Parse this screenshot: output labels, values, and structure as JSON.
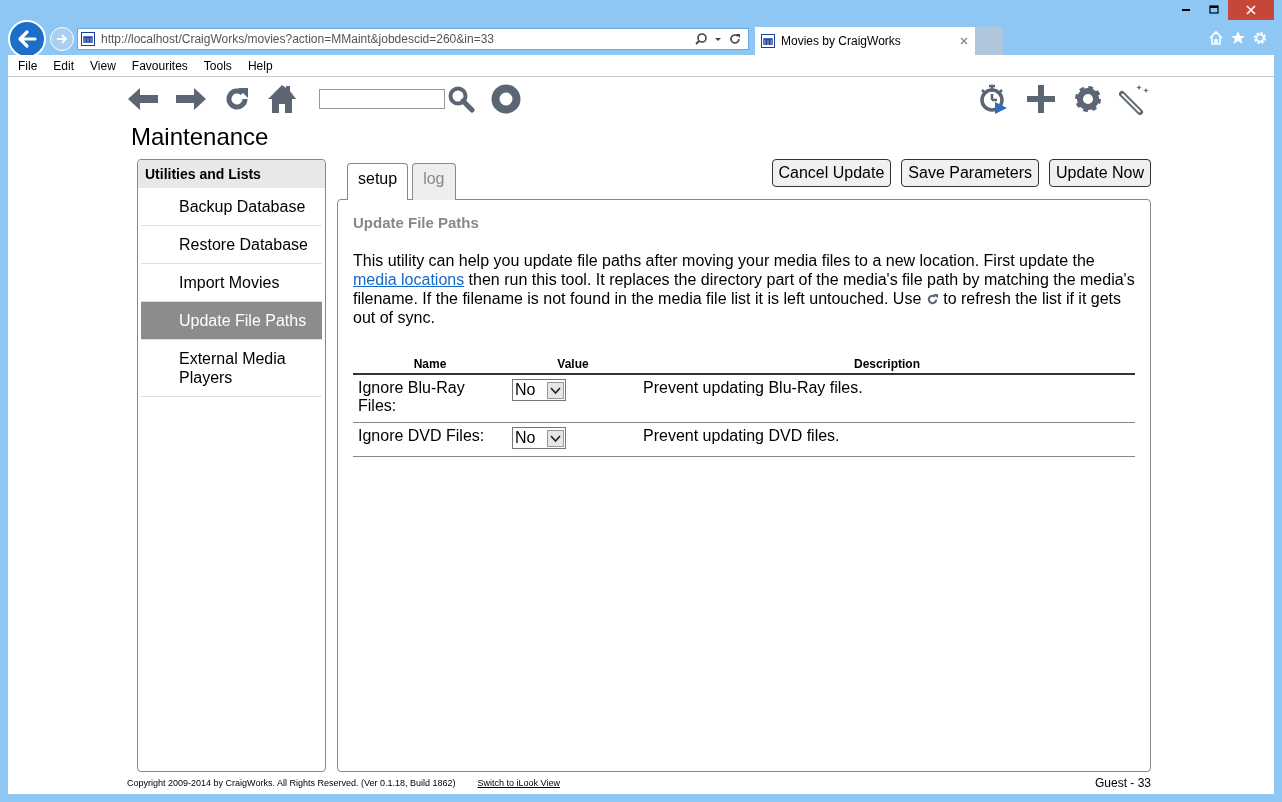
{
  "browser": {
    "address": "http://localhost/CraigWorks/movies?action=MMaint&jobdescid=260&in=33",
    "tab_title": "Movies by CraigWorks",
    "menu": [
      "File",
      "Edit",
      "View",
      "Favourites",
      "Tools",
      "Help"
    ]
  },
  "page_title": "Maintenance",
  "sidebar": {
    "title": "Utilities and Lists",
    "items": [
      {
        "label": "Backup Database",
        "selected": false
      },
      {
        "label": "Restore Database",
        "selected": false
      },
      {
        "label": "Import Movies",
        "selected": false
      },
      {
        "label": "Update File Paths",
        "selected": true
      },
      {
        "label": "External Media Players",
        "selected": false
      }
    ]
  },
  "tabs": [
    {
      "label": "setup",
      "selected": true
    },
    {
      "label": "log",
      "selected": false
    }
  ],
  "buttons": [
    "Cancel Update",
    "Save Parameters",
    "Update Now"
  ],
  "panel": {
    "title": "Update File Paths",
    "description": {
      "before_link": "This utility can help you update file paths after moving your media files to a new location. First update the",
      "link": "media locations",
      "after_link": "then run this tool. It replaces the directory part of the media's file path by matching the media's filename. If the filename is not found in the media file list it is left untouched. Use",
      "after_icon": "to refresh the list if it gets out of sync."
    },
    "table": {
      "columns": [
        "Name",
        "Value",
        "Description"
      ],
      "rows": [
        {
          "name": "Ignore Blu-Ray Files:",
          "value": "No",
          "description": "Prevent updating Blu-Ray files."
        },
        {
          "name": "Ignore DVD Files:",
          "value": "No",
          "description": "Prevent updating DVD files."
        }
      ]
    }
  },
  "footer": {
    "copyright": "Copyright 2009-2014 by CraigWorks. All Rights Reserved. (Ver 0.1.18, Build 1862)",
    "link": "Switch to iLook View",
    "user": "Guest - 33"
  }
}
